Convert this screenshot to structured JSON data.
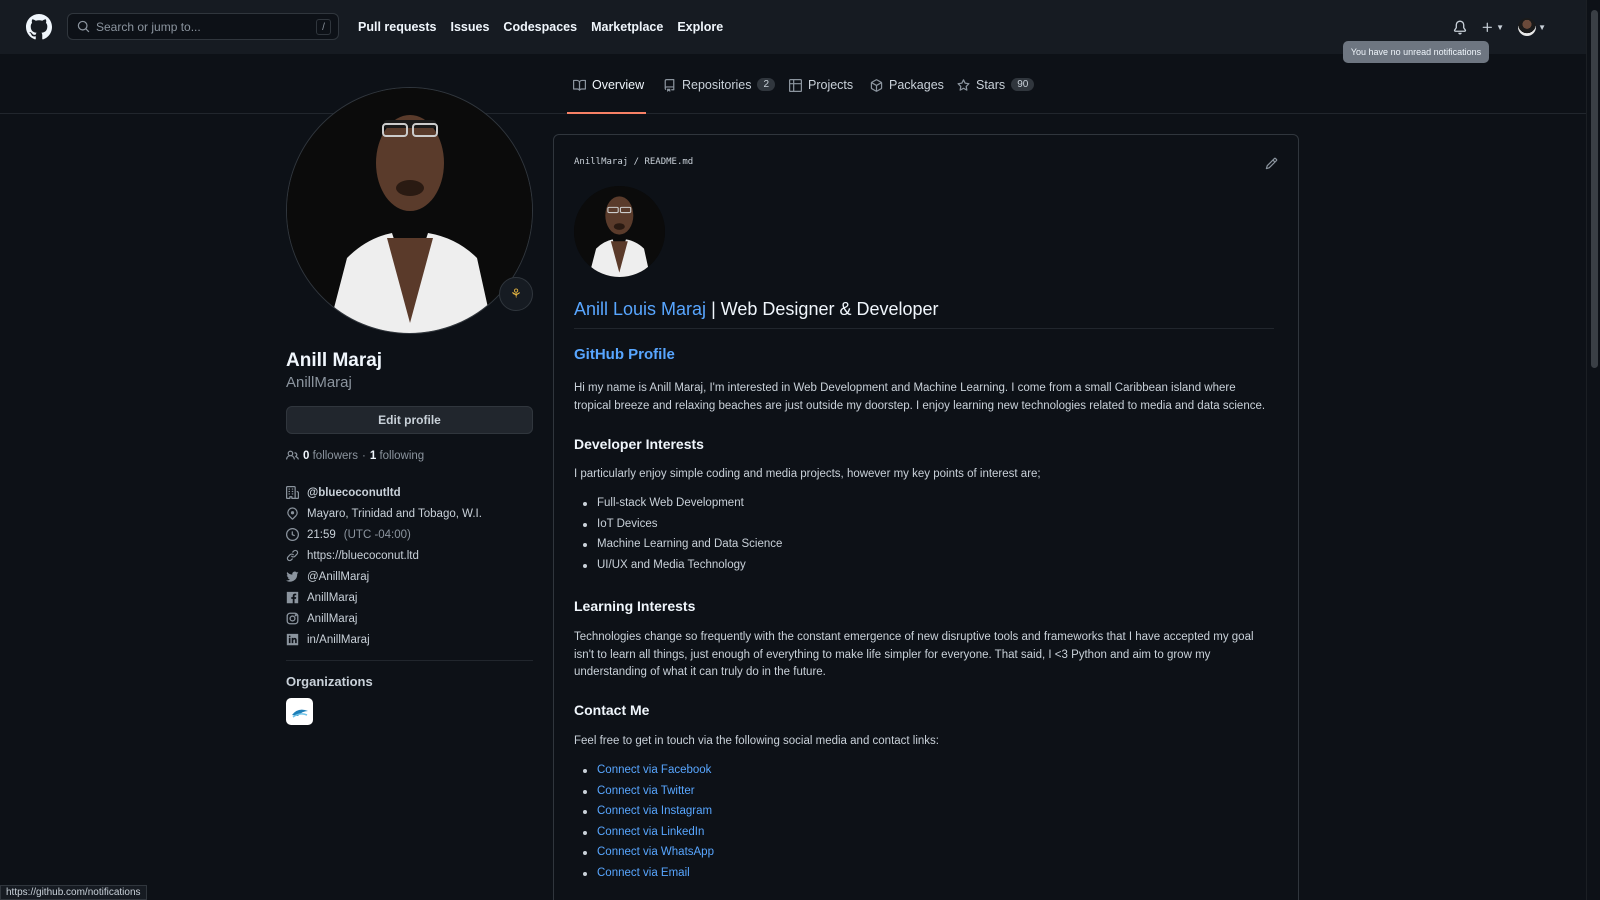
{
  "header": {
    "search_placeholder": "Search or jump to...",
    "search_shortcut": "/",
    "nav": [
      "Pull requests",
      "Issues",
      "Codespaces",
      "Marketplace",
      "Explore"
    ],
    "tooltip": "You have no unread notifications"
  },
  "tabs": [
    {
      "label": "Overview",
      "icon": "book-icon"
    },
    {
      "label": "Repositories",
      "count": "2",
      "icon": "repo-icon"
    },
    {
      "label": "Projects",
      "icon": "table-icon"
    },
    {
      "label": "Packages",
      "icon": "package-icon"
    },
    {
      "label": "Stars",
      "count": "90",
      "icon": "star-icon"
    }
  ],
  "profile": {
    "full_name": "Anill Maraj",
    "username": "AnillMaraj",
    "edit_label": "Edit profile",
    "followers_count": "0",
    "followers_label": "followers",
    "following_count": "1",
    "following_label": "following",
    "company": "@bluecoconutltd",
    "location": "Mayaro, Trinidad and Tobago, W.I.",
    "time": "21:59",
    "timezone": "(UTC -04:00)",
    "website": "https://bluecoconut.ltd",
    "twitter": "@AnillMaraj",
    "facebook": "AnillMaraj",
    "instagram": "AnillMaraj",
    "linkedin": "in/AnillMaraj",
    "organizations_heading": "Organizations"
  },
  "readme": {
    "path_user": "AnillMaraj",
    "path_sep": "/",
    "path_file": "README.md",
    "title_link": "Anill Louis Maraj",
    "title_rest": " | Web Designer & Developer",
    "subtitle": "GitHub Profile",
    "intro": "Hi my name is Anill Maraj, I'm interested in Web Development and Machine Learning. I come from a small Caribbean island where tropical breeze and relaxing beaches are just outside my doorstep. I enjoy learning new technologies related to media and data science.",
    "dev_heading": "Developer Interests",
    "dev_intro": "I particularly enjoy simple coding and media projects, however my key points of interest are;",
    "dev_items": [
      "Full-stack Web Development",
      "IoT Devices",
      "Machine Learning and Data Science",
      "UI/UX and Media Technology"
    ],
    "learn_heading": "Learning Interests",
    "learn_text": "Technologies change so frequently with the constant emergence of new disruptive tools and frameworks that I have accepted my goal isn't to learn all things, just enough of everything to make life simpler for everyone. That said, I <3 Python and aim to grow my understanding of what it can truly do in the future.",
    "contact_heading": "Contact Me",
    "contact_intro": "Feel free to get in touch via the following social media and contact links:",
    "contact_links": [
      "Connect via Facebook",
      "Connect via Twitter",
      "Connect via Instagram",
      "Connect via LinkedIn",
      "Connect via WhatsApp",
      "Connect via Email"
    ]
  },
  "statusbar": "https://github.com/notifications",
  "colors": {
    "accent": "#58a6ff",
    "tab_underline": "#f78166",
    "bg": "#0d1117",
    "header_bg": "#161b22"
  }
}
